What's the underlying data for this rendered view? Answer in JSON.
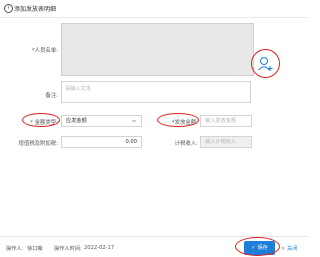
{
  "dialog": {
    "title": "添加发放表明细"
  },
  "form": {
    "person_name_label": "*人员名单:",
    "remark_label": "备注:",
    "remark_placeholder": "请输入文本",
    "amount_type_label": "* 金额类型:",
    "amount_type_value": "应发金额",
    "payout_amount_label": "*发放金额:",
    "payout_amount_placeholder": "输入发放金额",
    "tax_label": "增值税及附加税:",
    "tax_value": "0.00",
    "taxable_income_label": "计税收入:",
    "taxable_income_placeholder": "输入计税收入"
  },
  "footer": {
    "operator_label": "操作人:",
    "operator_name": "徐口薇",
    "operate_time_label": "操作人时间:",
    "operate_time": "2022-02-17",
    "save_label": "保存",
    "close_label": "关闭"
  },
  "icons": {
    "info": "info-circle-icon",
    "add_user": "add-user-icon",
    "dropdown": "chevron-down-icon",
    "save": "check-icon",
    "close": "close-icon"
  },
  "colors": {
    "accent": "#1e7fd9",
    "annotation": "#e02020",
    "required": "#e02020"
  }
}
